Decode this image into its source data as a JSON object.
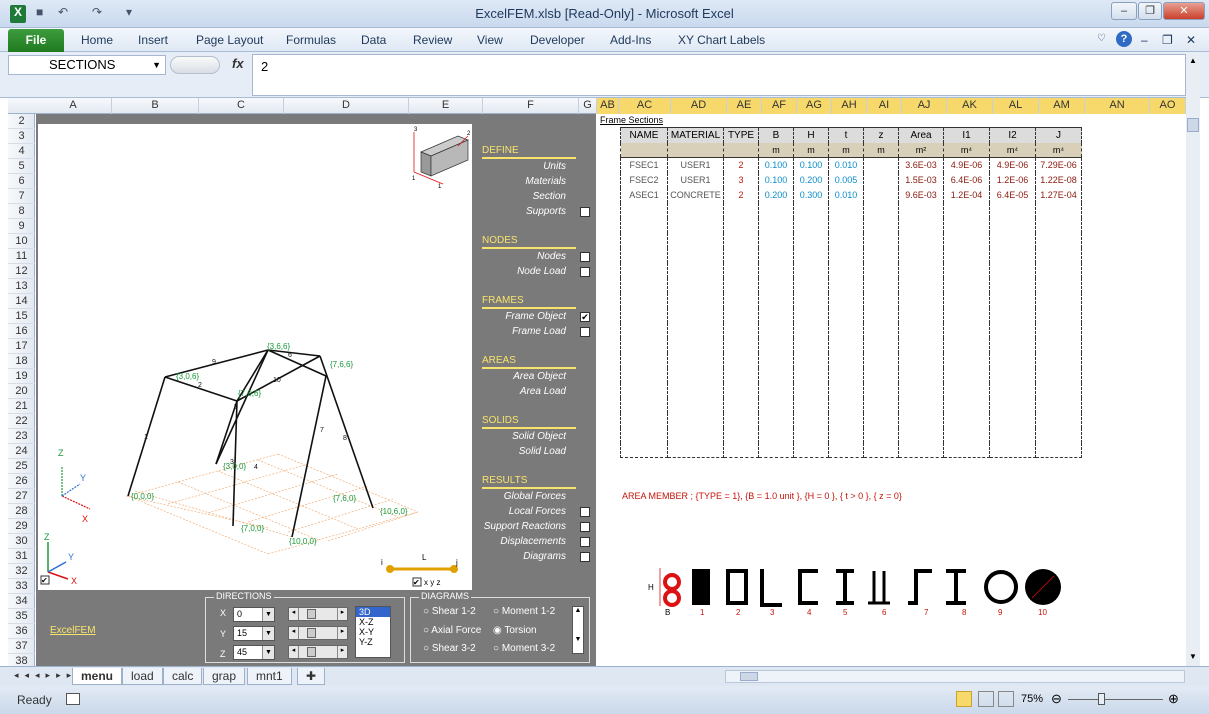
{
  "window": {
    "title": "ExcelFEM.xlsb  [Read-Only]  -  Microsoft Excel"
  },
  "ribbon": {
    "file": "File",
    "tabs": [
      "Home",
      "Insert",
      "Page Layout",
      "Formulas",
      "Data",
      "Review",
      "View",
      "Developer",
      "Add-Ins",
      "XY Chart Labels"
    ]
  },
  "formula": {
    "name_box": "SECTIONS",
    "fx": "fx",
    "value": "2"
  },
  "columns": [
    "A",
    "B",
    "C",
    "D",
    "E",
    "F",
    "G",
    "AB",
    "AC",
    "AD",
    "AE",
    "AF",
    "AG",
    "AH",
    "AI",
    "AJ",
    "AK",
    "AL",
    "AM",
    "AN",
    "AO"
  ],
  "rows": [
    "2",
    "3",
    "4",
    "5",
    "6",
    "7",
    "8",
    "9",
    "10",
    "11",
    "12",
    "13",
    "14",
    "15",
    "16",
    "17",
    "18",
    "19",
    "20",
    "21",
    "22",
    "23",
    "24",
    "25",
    "26",
    "27",
    "28",
    "29",
    "30",
    "31",
    "32",
    "33",
    "34",
    "35",
    "36",
    "37",
    "38"
  ],
  "menu": {
    "define": {
      "header": "DEFINE",
      "items": [
        "Units",
        "Materials",
        "Section",
        "Supports"
      ]
    },
    "nodes": {
      "header": "NODES",
      "items": [
        "Nodes",
        "Node Load"
      ]
    },
    "frames": {
      "header": "FRAMES",
      "items": [
        "Frame Object",
        "Frame Load"
      ]
    },
    "areas": {
      "header": "AREAS",
      "items": [
        "Area Object",
        "Area Load"
      ]
    },
    "solids": {
      "header": "SOLIDS",
      "items": [
        "Solid Object",
        "Solid Load"
      ]
    },
    "results": {
      "header": "RESULTS",
      "items": [
        "Global Forces",
        "Local Forces",
        "Support Reactions",
        "Displacements",
        "Diagrams"
      ]
    }
  },
  "model": {
    "labels": [
      "{0,0,0}",
      "{3,0,0}",
      "{7,0,0}",
      "{10,0,0}",
      "{10,6,0}",
      "{7,6,0}",
      "{3,6,6}",
      "{7,6,6}",
      "{3,0,6}",
      "{7,0,6}"
    ],
    "axes": [
      "Z",
      "Y",
      "X"
    ],
    "member_ids": [
      "1",
      "2",
      "3",
      "4",
      "5",
      "6",
      "7",
      "8",
      "9",
      "10"
    ],
    "local": [
      "i",
      "L",
      "j",
      "x y z"
    ]
  },
  "frame_sections": {
    "title": "Frame Sections",
    "headers": [
      "NAME",
      "MATERIAL",
      "TYPE",
      "B",
      "H",
      "t",
      "z",
      "Area",
      "I1",
      "I2",
      "J"
    ],
    "units": [
      "",
      "",
      "",
      "m",
      "m",
      "m",
      "m",
      "m²",
      "m⁴",
      "m⁴",
      "m⁴"
    ],
    "rows": [
      [
        "FSEC1",
        "USER1",
        "2",
        "0.100",
        "0.100",
        "0.010",
        "",
        "3.6E-03",
        "4.9E-06",
        "4.9E-06",
        "7.29E-06"
      ],
      [
        "FSEC2",
        "USER1",
        "3",
        "0.100",
        "0.200",
        "0.005",
        "",
        "1.5E-03",
        "6.4E-06",
        "1.2E-06",
        "1.22E-08"
      ],
      [
        "ASEC1",
        "CONCRETE",
        "2",
        "0.200",
        "0.300",
        "0.010",
        "",
        "9.6E-03",
        "1.2E-04",
        "6.4E-05",
        "1.27E-04"
      ]
    ],
    "note": "AREA MEMBER ; {TYPE = 1}, {B = 1.0 unit }, {H = 0 }, { t > 0 }, { z = 0}",
    "shape_ids": [
      "1",
      "2",
      "3",
      "4",
      "5",
      "6",
      "7",
      "8",
      "9",
      "10"
    ],
    "shape_dims": [
      "H",
      "B"
    ]
  },
  "directions": {
    "legend": "DIRECTIONS",
    "x": {
      "label": "X",
      "value": "0"
    },
    "y": {
      "label": "Y",
      "value": "15"
    },
    "z": {
      "label": "Z",
      "value": "45"
    },
    "views": [
      "3D",
      "X-Z",
      "X-Y",
      "Y-Z"
    ]
  },
  "diagrams": {
    "legend": "DIAGRAMS",
    "options": [
      "Shear 1-2",
      "Moment 1-2",
      "Axial Force",
      "Torsion",
      "Shear 3-2",
      "Moment 3-2"
    ]
  },
  "link": "ExcelFEM",
  "sheet_tabs": [
    "menu",
    "load",
    "calc",
    "grap",
    "mnt1"
  ],
  "status": {
    "ready": "Ready",
    "zoom": "75%"
  },
  "colors": {
    "accent": "#f8e36d",
    "panel": "#7a7a7a",
    "file_tab": "#2e8b2e"
  }
}
